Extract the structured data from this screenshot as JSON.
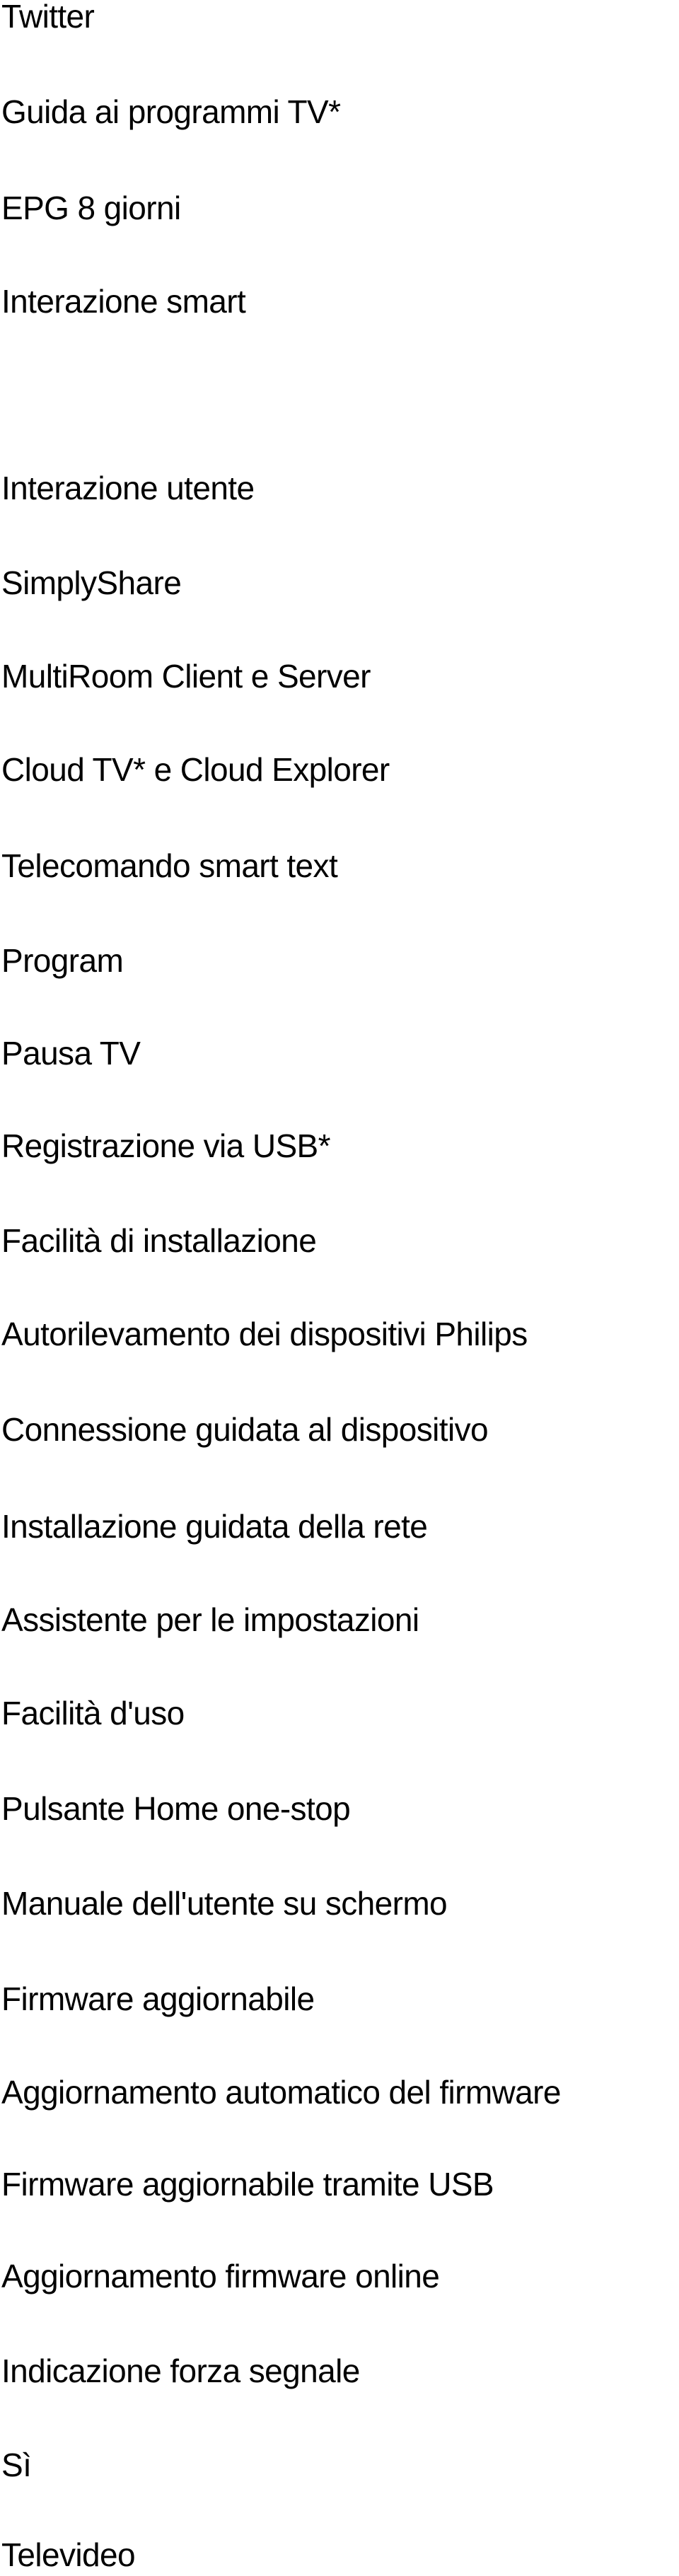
{
  "document": {
    "lines": [
      "Twitter",
      "Guida ai programmi TV*",
      "EPG 8 giorni",
      "Interazione smart",
      "",
      "Interazione utente",
      "SimplyShare",
      "MultiRoom Client e Server",
      "Cloud TV* e Cloud Explorer",
      "Telecomando smart text",
      "Program",
      "Pausa TV",
      "Registrazione via USB*",
      "Facilità di installazione",
      "Autorilevamento dei dispositivi Philips",
      "Connessione guidata al dispositivo",
      "Installazione guidata della rete",
      "Assistente per le impostazioni",
      "Facilità d'uso",
      "Pulsante Home one-stop",
      "Manuale dell'utente su schermo",
      "Firmware aggiornabile",
      "Aggiornamento automatico del firmware",
      "Firmware aggiornabile tramite USB",
      "Aggiornamento firmware online",
      "Indicazione forza segnale",
      "Sì",
      "Televideo"
    ]
  }
}
